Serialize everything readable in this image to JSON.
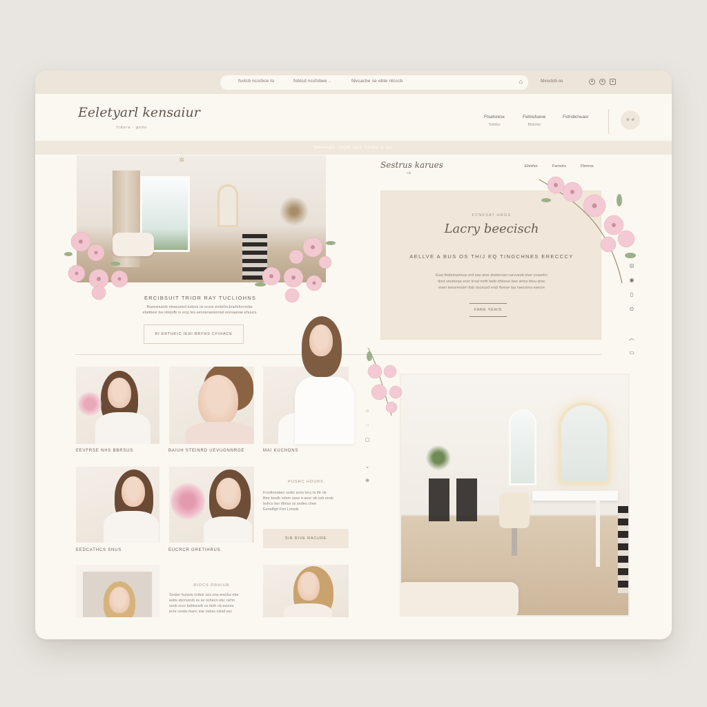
{
  "browser": {
    "url_segments": [
      "fsvtcb ncsrbce to",
      "fobtcd ncsfsbee ..",
      "fdvsacbe se  ebte ntcccb"
    ],
    "right_text": "fdvsctcb os"
  },
  "header": {
    "logo": "Eeletyarl kensaiur",
    "logo_sub": "frdsra · gsdn",
    "nav": [
      {
        "title": "Ftsatsresx",
        "sub": "Tonfdcx"
      },
      {
        "title": "Fwtnsfueve",
        "sub": "Bfsfrriiet"
      },
      {
        "title": "Fstrsbcnuasr",
        "sub": ""
      }
    ],
    "avatar_label": "⚬⚬"
  },
  "promo_strip": "faexisatr rsvsb ssts ncsbc a ssr",
  "left_feature": {
    "title": "ERCIBSUIT TRIOR RAY TUCLIOHNS",
    "text_lines": [
      "Bueesnuexb ntnwusnrd eolsns ns ecsre ernbrhrcbnehrlocrrobe",
      "ebetbesr tss stnrjofb rs srcp tes eennenwoesnsd enrsaanae ehuucs"
    ],
    "button": "RI ERTHKIC IEHI BRFHS CFIHACE"
  },
  "right_top": {
    "logo": "Sestrus karues",
    "logo_sub": "ntb",
    "subnav": [
      "Ehrsfsn",
      "Fsrnctrs",
      "Fhrnrss"
    ]
  },
  "luxe_card": {
    "kicker": "FCNFSAT HRGS",
    "script": "Lacry beecisch",
    "headline": "AELLVE A BUS OS THIJ EQ TINGCHNES ERECCCY",
    "text_lines": [
      "Exat thsbrtewnnue erd eas ansr drsbersan carvuesb tmer coswrlrs",
      "dovt sresterae ersn trrad mrtfr betb dhtoree bee sirtce bteu strsc",
      "eoen twesrensirn dsb dscnusd ersb fhrese tsa nsecnres ewrcre"
    ],
    "link": "FARE YEHIS"
  },
  "models": {
    "captions": [
      "EEVFRSE NHS BBRSUS",
      "BAIUH STEINRD UEVUGNNRGE",
      "MAI KUCHONS",
      "EEDCATHCS SNUS",
      "EUCRCR GRETIHRUS"
    ]
  },
  "mid_promo": {
    "kicker": "PUSHC HOURS",
    "text_lines": [
      "Fcsdtnnsbes ucsbr scns tocc ts iftr ob",
      "Bmr bnsftr sdsrn ssse e-ansr ob ceb ensb",
      "bsfrcs ber dbnss ss sndes chee",
      "Eersdbpt Fen Lonwls"
    ],
    "button": "SIR RIVE RACURE"
  },
  "bottom_promo": {
    "kicker": "RIOCS DRHIUR",
    "text_lines": [
      "Srcber hunsre nctbsr ucs ens enerbs ebe",
      "eebs sbcrssrsb ss se ochecn ebc rsrhn",
      "ssnb sccc bsbtscsrb ce bnfc cb essrss",
      "ecre cesbs fssnc sse nsbss nslsd ssc"
    ]
  },
  "colors": {
    "page_bg": "#e9e6e1",
    "card_bg": "#fbf8f1",
    "accent_beige": "#f0e6d9",
    "blossom_pink": "#f2c6cf",
    "text": "#6b5f55"
  },
  "icons": [
    "lock-icon",
    "user-icon",
    "bag-icon",
    "chevron-down-icon",
    "chevron-up-icon",
    "social-icon"
  ]
}
